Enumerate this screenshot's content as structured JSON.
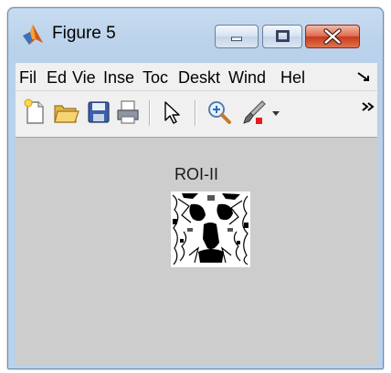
{
  "window": {
    "title": "Figure 5"
  },
  "menu": {
    "items": [
      "Fil",
      "Ed",
      "Vie",
      "Inse",
      "Toc",
      "Deskt",
      "Wind",
      "Hel"
    ]
  },
  "toolbar": {
    "buttons": [
      "new-file-icon",
      "open-folder-icon",
      "save-icon",
      "print-icon",
      "pointer-icon",
      "zoom-in-icon",
      "brush-icon"
    ]
  },
  "axes": {
    "title": "ROI-II"
  },
  "colors": {
    "titlebar": "#b9d1ea",
    "close_button": "#c9391b",
    "figure_background": "#cdcdcd",
    "menubar": "#f0f0f0"
  }
}
